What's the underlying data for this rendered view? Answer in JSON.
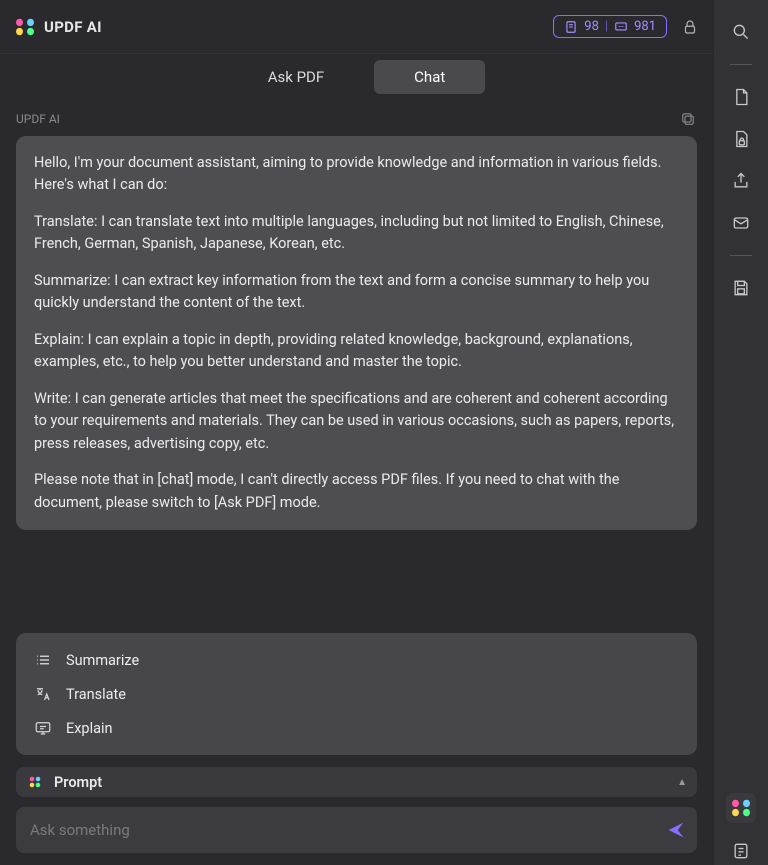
{
  "header": {
    "title": "UPDF AI",
    "credits": {
      "doc_count": "98",
      "chat_count": "981"
    }
  },
  "tabs": {
    "ask_pdf": "Ask PDF",
    "chat": "Chat",
    "active": "chat"
  },
  "section_label": "UPDF AI",
  "message": {
    "intro": "Hello, I'm your document assistant, aiming to provide knowledge and information in various fields. Here's what I can do:",
    "translate": "Translate: I can translate text into multiple languages, including but not limited to English, Chinese, French, German, Spanish, Japanese, Korean, etc.",
    "summarize": "Summarize: I can extract key information from the text and form a concise summary to help you quickly understand the content of the text.",
    "explain": "Explain: I can explain a topic in depth, providing related knowledge, background, explanations, examples, etc., to help you better understand and master the topic.",
    "write": "Write: I can generate articles that meet the specifications and are coherent and coherent according to your requirements and materials. They can be used in various occasions, such as papers, reports, press releases, advertising copy, etc.",
    "note": "Please note that in [chat] mode, I can't directly access PDF files. If you need to chat with the document, please switch to [Ask PDF] mode."
  },
  "suggestions": {
    "summarize": "Summarize",
    "translate": "Translate",
    "explain": "Explain"
  },
  "prompt": {
    "label": "Prompt"
  },
  "input": {
    "placeholder": "Ask something"
  }
}
